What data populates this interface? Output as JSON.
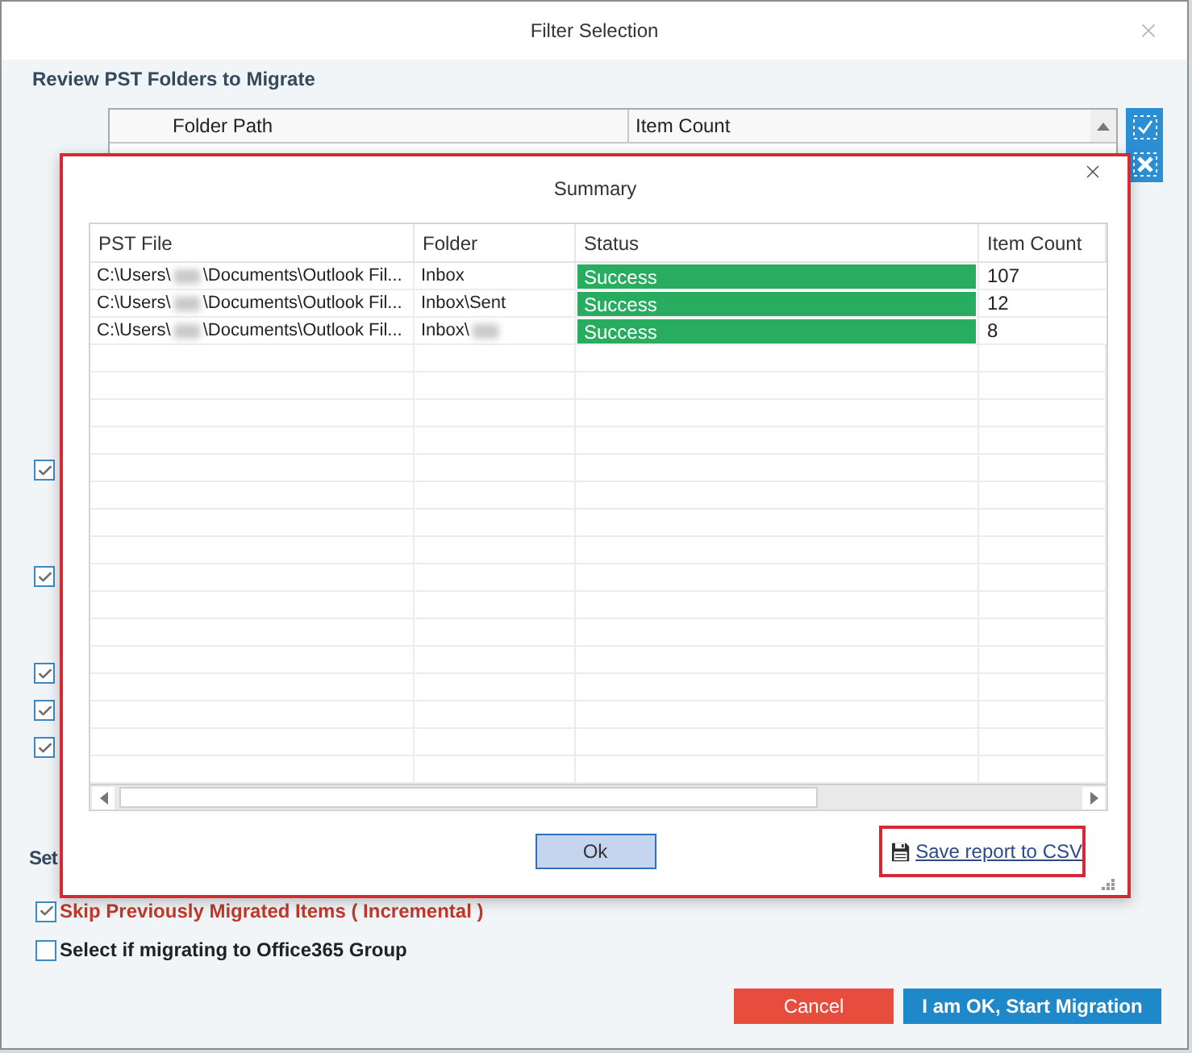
{
  "window": {
    "title": "Filter Selection"
  },
  "section_title": "Review PST Folders to Migrate",
  "folder_table": {
    "columns": [
      "Folder Path",
      "Item Count"
    ]
  },
  "option_checkboxes": [
    {
      "checked": true
    },
    {
      "checked": true
    },
    {
      "checked": true
    },
    {
      "checked": true
    },
    {
      "checked": true
    }
  ],
  "settings": {
    "heading": "Set",
    "options": [
      {
        "label": "Skip Previously Migrated Items ( Incremental )",
        "checked": true,
        "emphasis": true
      },
      {
        "label": "Select if migrating to Office365 Group",
        "checked": false,
        "emphasis": false
      }
    ]
  },
  "buttons": [
    {
      "label": "Cancel",
      "kind": "danger"
    },
    {
      "label": "I am OK, Start Migration",
      "kind": "primary"
    }
  ],
  "summary": {
    "title": "Summary",
    "columns": [
      "PST File",
      "Folder",
      "Status",
      "Item Count"
    ],
    "rows": [
      {
        "pst_file": {
          "before": "C:\\Users\\",
          "redacted": true,
          "after": "\\Documents\\Outlook Fil..."
        },
        "folder": {
          "before": "Inbox",
          "redacted": false
        },
        "status": "Success",
        "color": "#28ad60",
        "item_count": "107"
      },
      {
        "pst_file": {
          "before": "C:\\Users\\",
          "redacted": true,
          "after": "\\Documents\\Outlook Fil..."
        },
        "folder": {
          "before": "Inbox\\Sent",
          "redacted": false
        },
        "status": "Success",
        "color": "#28ad60",
        "item_count": "12"
      },
      {
        "pst_file": {
          "before": "C:\\Users\\",
          "redacted": true,
          "after": "\\Documents\\Outlook Fil..."
        },
        "folder": {
          "before": "Inbox\\",
          "redacted": true
        },
        "status": "Success",
        "color": "#28ad60",
        "item_count": "8"
      }
    ],
    "ok_button": "Ok",
    "save_link": "Save report to CSV"
  }
}
